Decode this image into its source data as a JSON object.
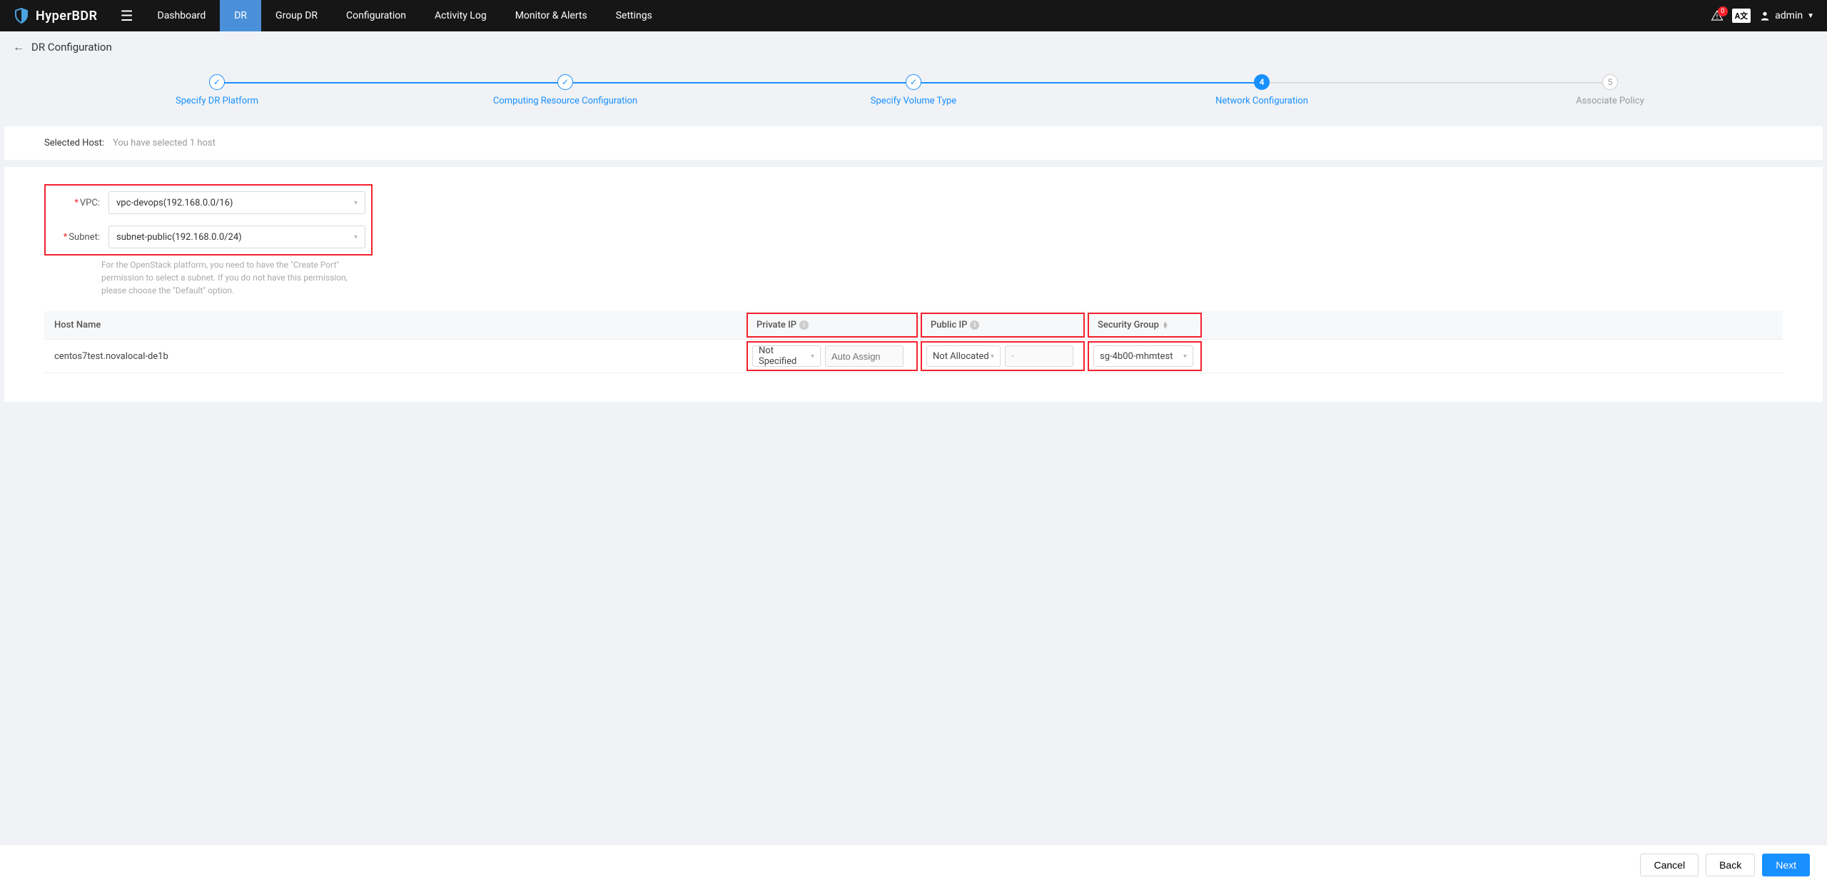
{
  "app": {
    "name": "HyperBDR"
  },
  "nav": {
    "items": [
      "Dashboard",
      "DR",
      "Group DR",
      "Configuration",
      "Activity Log",
      "Monitor & Alerts",
      "Settings"
    ],
    "active_index": 1
  },
  "topbar": {
    "alert_badge": "0",
    "lang_label": "A文",
    "user": "admin"
  },
  "breadcrumb": {
    "title": "DR Configuration"
  },
  "steps": {
    "items": [
      {
        "label": "Specify DR Platform",
        "state": "done"
      },
      {
        "label": "Computing Resource Configuration",
        "state": "done"
      },
      {
        "label": "Specify Volume Type",
        "state": "done"
      },
      {
        "label": "Network Configuration",
        "state": "current",
        "num": "4"
      },
      {
        "label": "Associate Policy",
        "state": "pending",
        "num": "5"
      }
    ]
  },
  "selected_host": {
    "label": "Selected Host:",
    "value": "You have selected 1 host"
  },
  "form": {
    "vpc_label": "VPC:",
    "vpc_value": "vpc-devops(192.168.0.0/16)",
    "subnet_label": "Subnet:",
    "subnet_value": "subnet-public(192.168.0.0/24)",
    "helper": "For the OpenStack platform, you need to have the \"Create Port\" permission to select a subnet. If you do not have this permission, please choose the \"Default\" option."
  },
  "table": {
    "headers": {
      "host": "Host Name",
      "private_ip": "Private IP",
      "public_ip": "Public IP",
      "security_group": "Security Group"
    },
    "rows": [
      {
        "host": "centos7test.novalocal-de1b",
        "private_ip_mode": "Not Specified",
        "private_ip_placeholder": "Auto Assign",
        "public_ip_mode": "Not Allocated",
        "public_ip_value": "-",
        "security_group": "sg-4b00-mhmtest"
      }
    ]
  },
  "footer": {
    "cancel": "Cancel",
    "back": "Back",
    "next": "Next"
  }
}
